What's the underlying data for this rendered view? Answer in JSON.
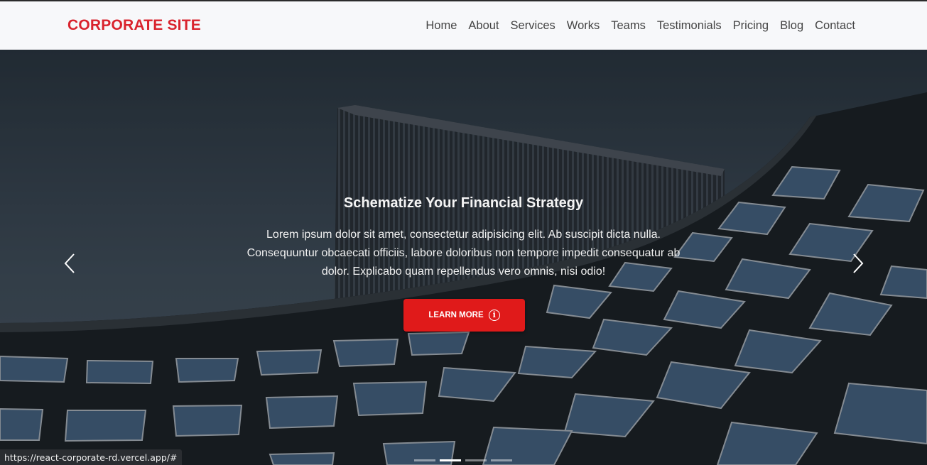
{
  "navbar": {
    "brand": "CORPORATE SITE",
    "links": [
      "Home",
      "About",
      "Services",
      "Works",
      "Teams",
      "Testimonials",
      "Pricing",
      "Blog",
      "Contact"
    ]
  },
  "hero": {
    "title": "Schematize Your Financial Strategy",
    "text": "Lorem ipsum dolor sit amet, consectetur adipisicing elit. Ab suscipit dicta nulla. Consequuntur obcaecati officiis, labore doloribus non tempore impedit consequatur ab dolor. Explicabo quam repellendus vero omnis, nisi odio!",
    "button_label": "LEARN MORE",
    "button_icon": "info-icon",
    "prev_icon": "chevron-left-icon",
    "next_icon": "chevron-right-icon",
    "slide_count": 4,
    "active_slide": 2
  },
  "status_bar": {
    "url": "https://react-corporate-rd.vercel.app/#"
  },
  "colors": {
    "brand": "#d9232d",
    "button": "#e01a1a",
    "navbar_bg": "#f7f8fa"
  }
}
